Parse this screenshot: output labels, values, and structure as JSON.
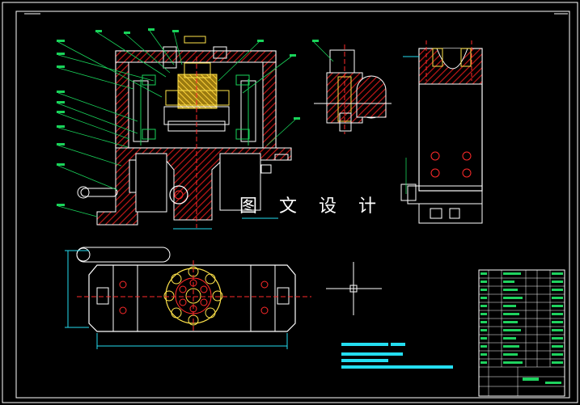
{
  "drawing": {
    "watermark_text": "图 文 设 计"
  },
  "colors": {
    "background": "#000000",
    "border": "#ffffff",
    "outline": "#ffffff",
    "part_red": "#ff2a2a",
    "part_green": "#19d35a",
    "part_yellow": "#ffe34a",
    "dimension_cyan": "#24ddf0",
    "hatch_red": "#c41818",
    "table_green": "#1fd35f"
  },
  "icons": [
    "crosshair-icon"
  ]
}
